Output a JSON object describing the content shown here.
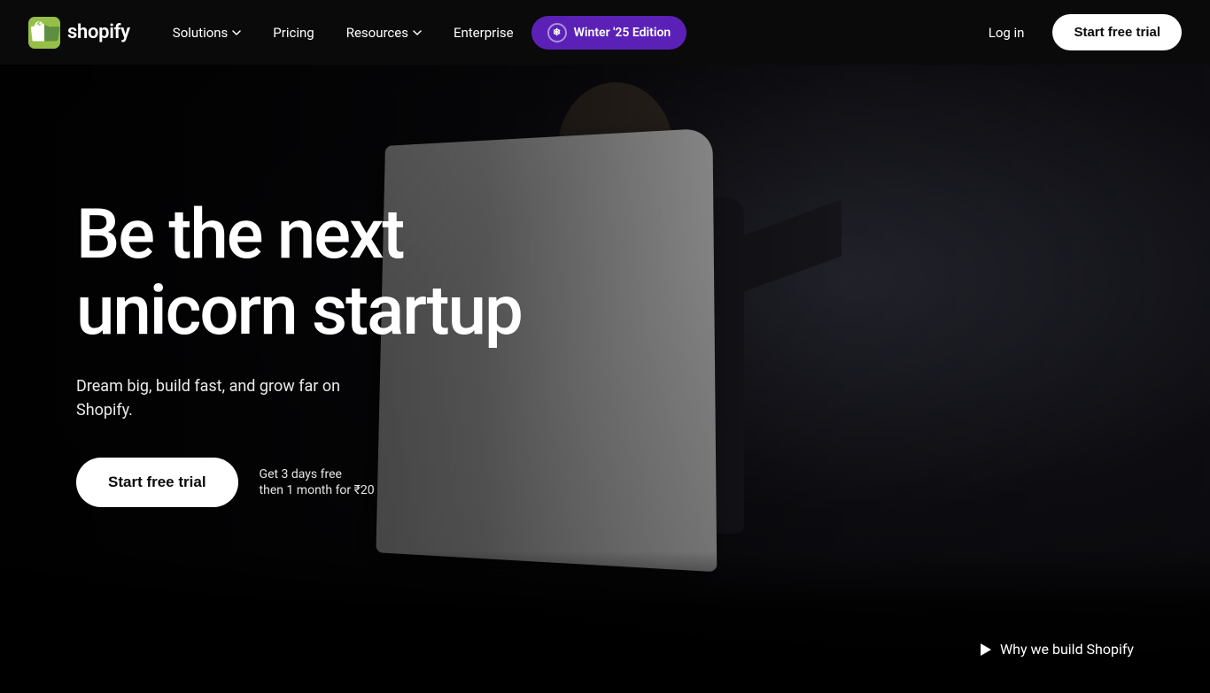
{
  "navbar": {
    "logo_text": "shopify",
    "nav_items": [
      {
        "label": "Solutions",
        "has_dropdown": true
      },
      {
        "label": "Pricing",
        "has_dropdown": false
      },
      {
        "label": "Resources",
        "has_dropdown": true
      },
      {
        "label": "Enterprise",
        "has_dropdown": false
      }
    ],
    "winter_badge_label": "Winter '25 Edition",
    "login_label": "Log in",
    "trial_button_label": "Start free trial"
  },
  "hero": {
    "headline_line1": "Be the next",
    "headline_line2": "unicorn startup",
    "subtext": "Dream big, build fast, and grow far on Shopify.",
    "cta_button_label": "Start free trial",
    "trial_info_line1": "Get 3 days free",
    "trial_info_line2": "then 1 month for ₹20",
    "why_link_label": "Why we build Shopify"
  }
}
